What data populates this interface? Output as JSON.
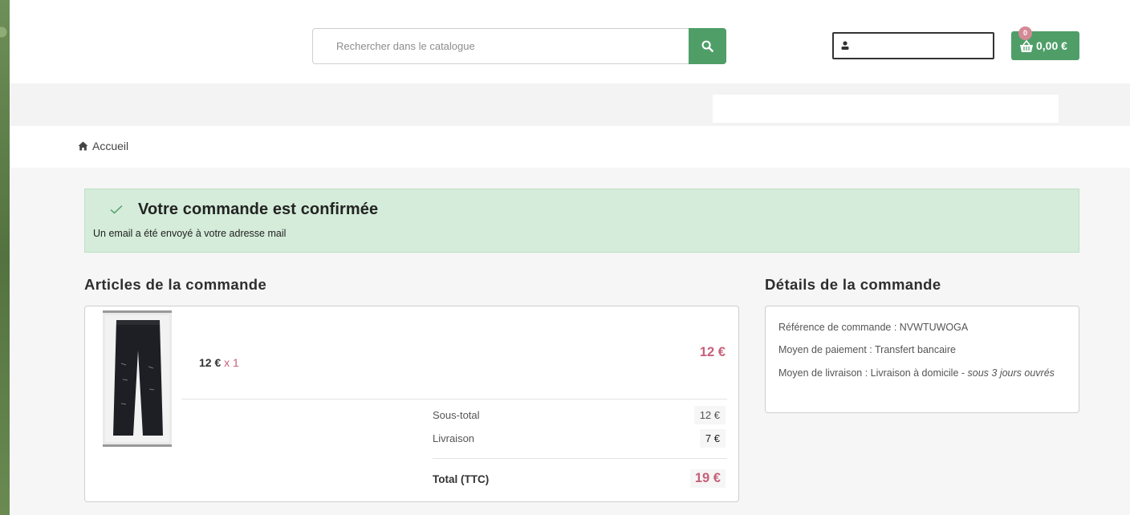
{
  "header": {
    "search": {
      "placeholder": "Rechercher dans le catalogue",
      "value": ""
    },
    "cart": {
      "count": "0",
      "amount": "0,00 €"
    }
  },
  "breadcrumb": {
    "home_label": "Accueil"
  },
  "alert": {
    "title": "Votre commande est confirmée",
    "message": "Un email a été envoyé à votre adresse mail"
  },
  "articles": {
    "heading": "Articles de la commande",
    "items": [
      {
        "unit_price": "12 €",
        "quantity": "x 1",
        "total": "12 €"
      }
    ],
    "summary": {
      "subtotal_label": "Sous-total",
      "subtotal_value": "12 €",
      "shipping_label": "Livraison",
      "shipping_value": "7 €",
      "total_label": "Total (TTC)",
      "total_value": "19 €"
    }
  },
  "details": {
    "heading": "Détails de la commande",
    "reference": "Référence de commande : NVWTUWOGA",
    "payment": "Moyen de paiement : Transfert bancaire",
    "shipping": "Moyen de livraison : Livraison à domicile - ",
    "shipping_delay": "sous 3 jours ouvrés"
  },
  "colors": {
    "accent_green": "#4f9e68",
    "price_pink": "#c7607a",
    "alert_bg": "#d4ecd9"
  }
}
